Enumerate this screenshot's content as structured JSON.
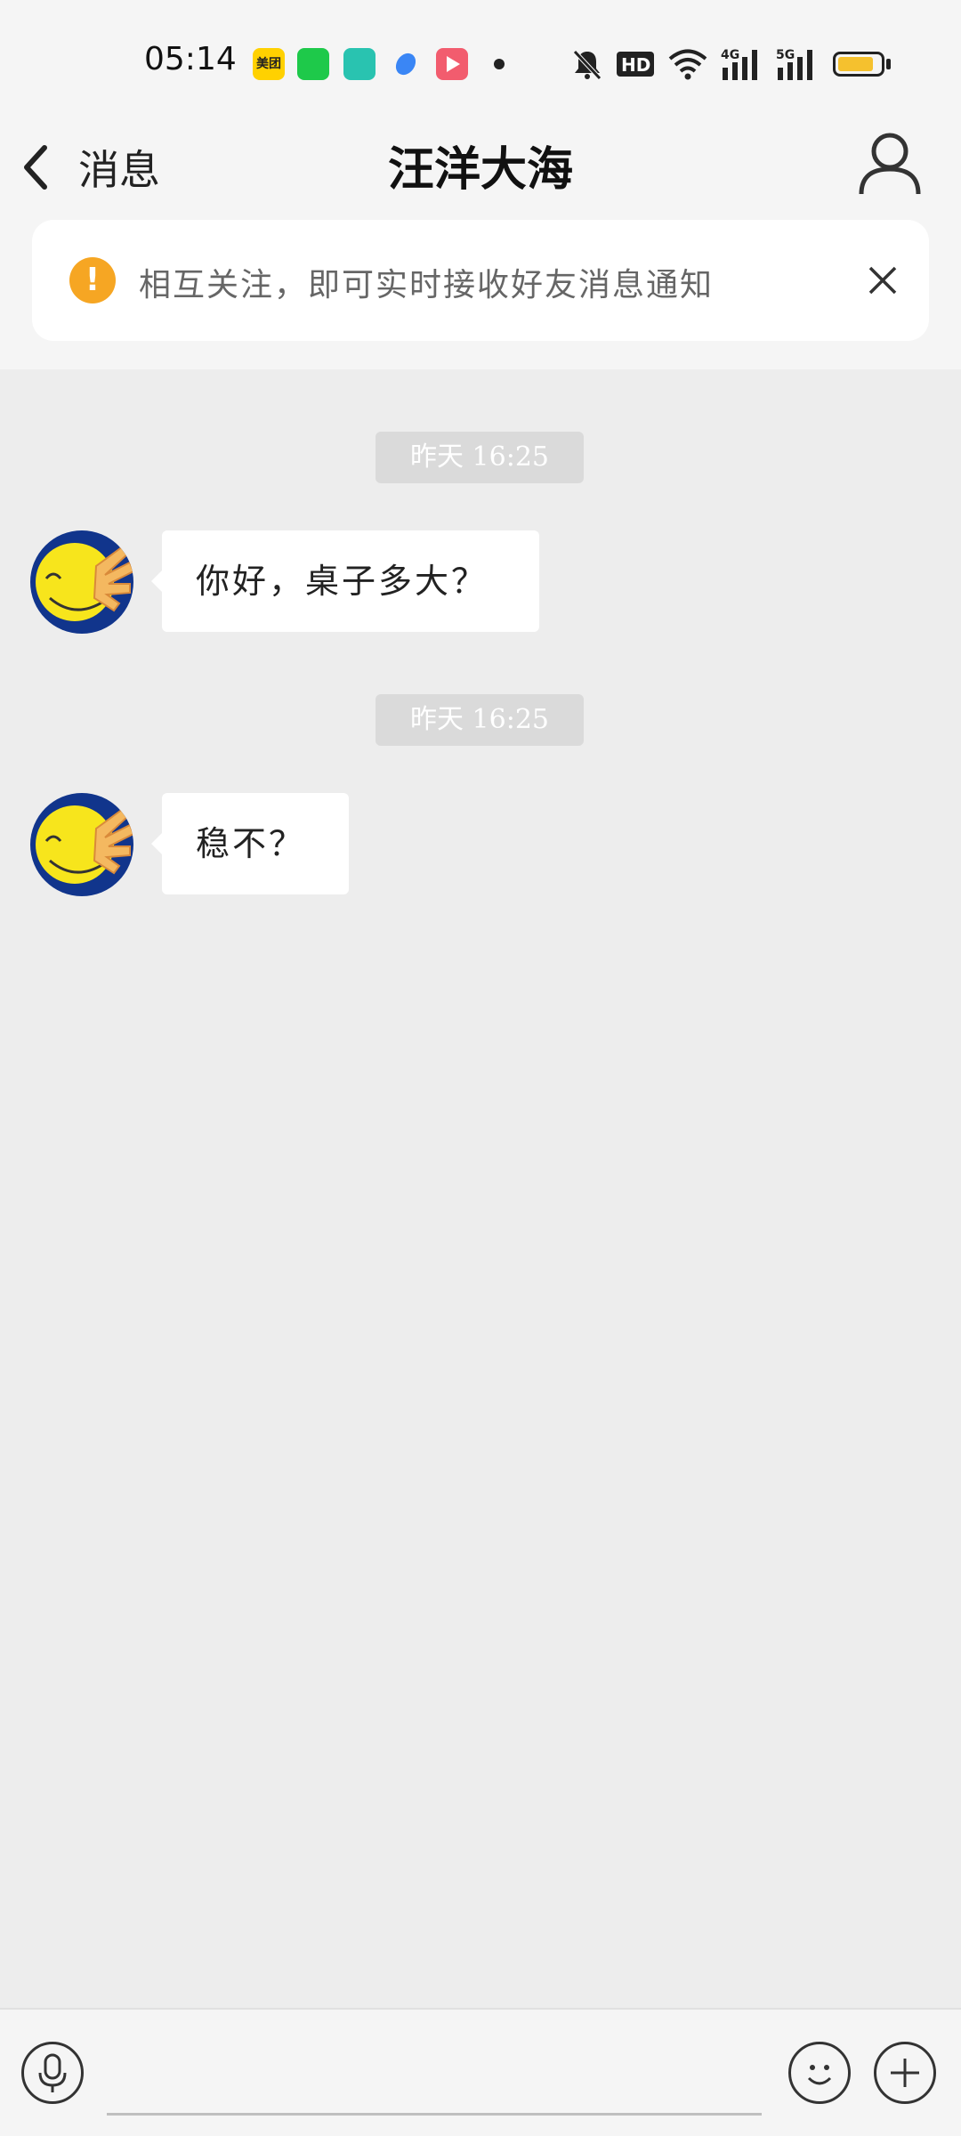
{
  "status_bar": {
    "time": "05:14",
    "apps": [
      {
        "name": "meituan-icon",
        "label": "美团",
        "color": "#ffd100"
      },
      {
        "name": "app-green-icon",
        "label": "",
        "color": "#1ec94a"
      },
      {
        "name": "app-teal-icon",
        "label": "",
        "color": "#29c3b0"
      },
      {
        "name": "app-blue-icon",
        "label": "",
        "color": "#3a86f5"
      },
      {
        "name": "video-app-icon",
        "label": "",
        "color": "#f25c6e"
      }
    ],
    "network_labels": [
      "HD",
      "4G",
      "5G"
    ],
    "battery_level": 0.85,
    "battery_color": "#f5c12e"
  },
  "header": {
    "back_label": "消息",
    "title": "汪洋大海"
  },
  "notice": {
    "text": "相互关注，即可实时接收好友消息通知",
    "icon": "!",
    "icon_color": "#f6a623"
  },
  "messages": [
    {
      "timestamp": "昨天 16:25",
      "text": "你好，桌子多大？"
    },
    {
      "timestamp": "昨天 16:25",
      "text": "稳不？"
    }
  ],
  "input": {
    "placeholder": ""
  },
  "colors": {
    "background": "#ededed",
    "bar": "#f5f5f5",
    "bubble": "#ffffff",
    "avatar_bg": "#11358c",
    "avatar_face": "#f7e51c"
  }
}
